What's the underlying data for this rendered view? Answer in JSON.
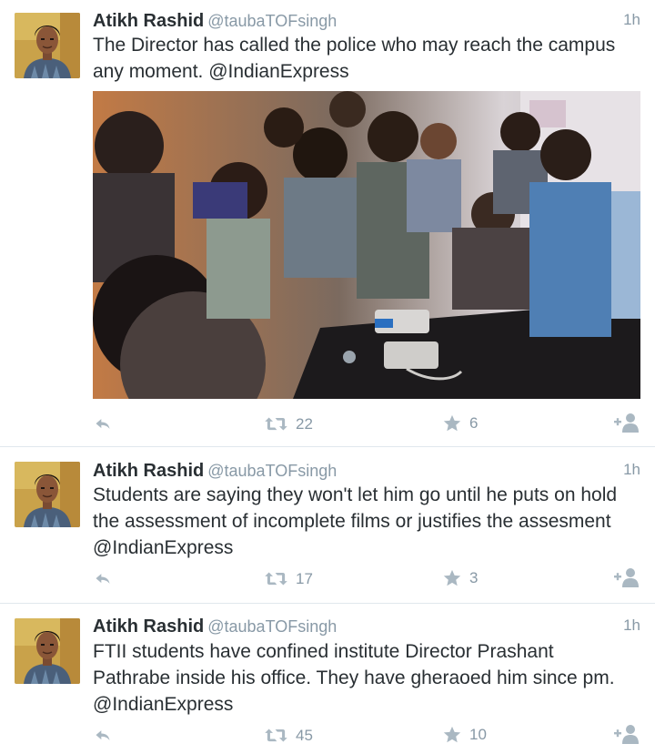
{
  "tweets": [
    {
      "author": "Atikh Rashid",
      "handle": "@taubaTOFsingh",
      "time": "1h",
      "lines": [
        "The Director has called the police who may reach the campus",
        "any moment. @IndianExpress"
      ],
      "retweets": "22",
      "favorites": "6",
      "has_photo": true
    },
    {
      "author": "Atikh Rashid",
      "handle": "@taubaTOFsingh",
      "time": "1h",
      "lines": [
        "Students are saying they won't let him go until he puts on hold",
        "the assessment of incomplete films or justifies the assesment",
        "@IndianExpress"
      ],
      "retweets": "17",
      "favorites": "3",
      "has_photo": false
    },
    {
      "author": "Atikh Rashid",
      "handle": "@taubaTOFsingh",
      "time": "1h",
      "lines": [
        "FTII students have confined institute Director Prashant",
        "Pathrabe inside his office.  They have gheraoed him since pm.",
        "@IndianExpress"
      ],
      "retweets": "45",
      "favorites": "10",
      "has_photo": false
    }
  ],
  "colors": {
    "name": "#292f33",
    "meta": "#8899a6",
    "icon": "#aab8c2",
    "divider": "#e1e8ed"
  },
  "icons": [
    "reply-icon",
    "retweet-icon",
    "favorite-star-icon",
    "follow-user-icon"
  ]
}
